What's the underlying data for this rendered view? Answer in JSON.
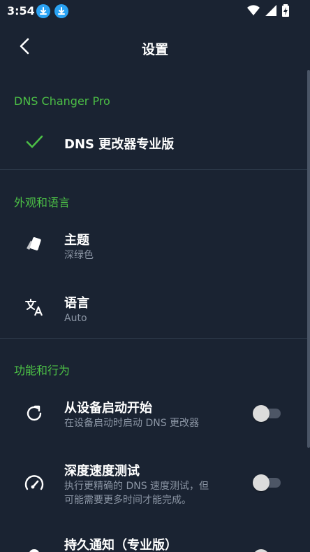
{
  "status_bar": {
    "time": "3:54"
  },
  "header": {
    "title": "设置"
  },
  "sections": {
    "pro": {
      "header": "DNS Changer Pro",
      "item_title": "DNS 更改器专业版"
    },
    "appearance": {
      "header": "外观和语言",
      "theme": {
        "title": "主题",
        "subtitle": "深绿色"
      },
      "language": {
        "title": "语言",
        "subtitle": "Auto"
      }
    },
    "behavior": {
      "header": "功能和行为",
      "boot_start": {
        "title": "从设备启动开始",
        "subtitle": "在设备启动时启动 DNS 更改器",
        "enabled": false
      },
      "deep_speed_test": {
        "title": "深度速度测试",
        "subtitle_line1": "执行更精确的 DNS 速度测试，但",
        "subtitle_line2": "可能需要更多时间才能完成。",
        "enabled": false
      },
      "persistent_notification": {
        "title": "持久通知（专业版）"
      }
    }
  },
  "colors": {
    "background": "#1a2332",
    "accent": "#4cbf46",
    "subtitle": "#8c96a5"
  }
}
